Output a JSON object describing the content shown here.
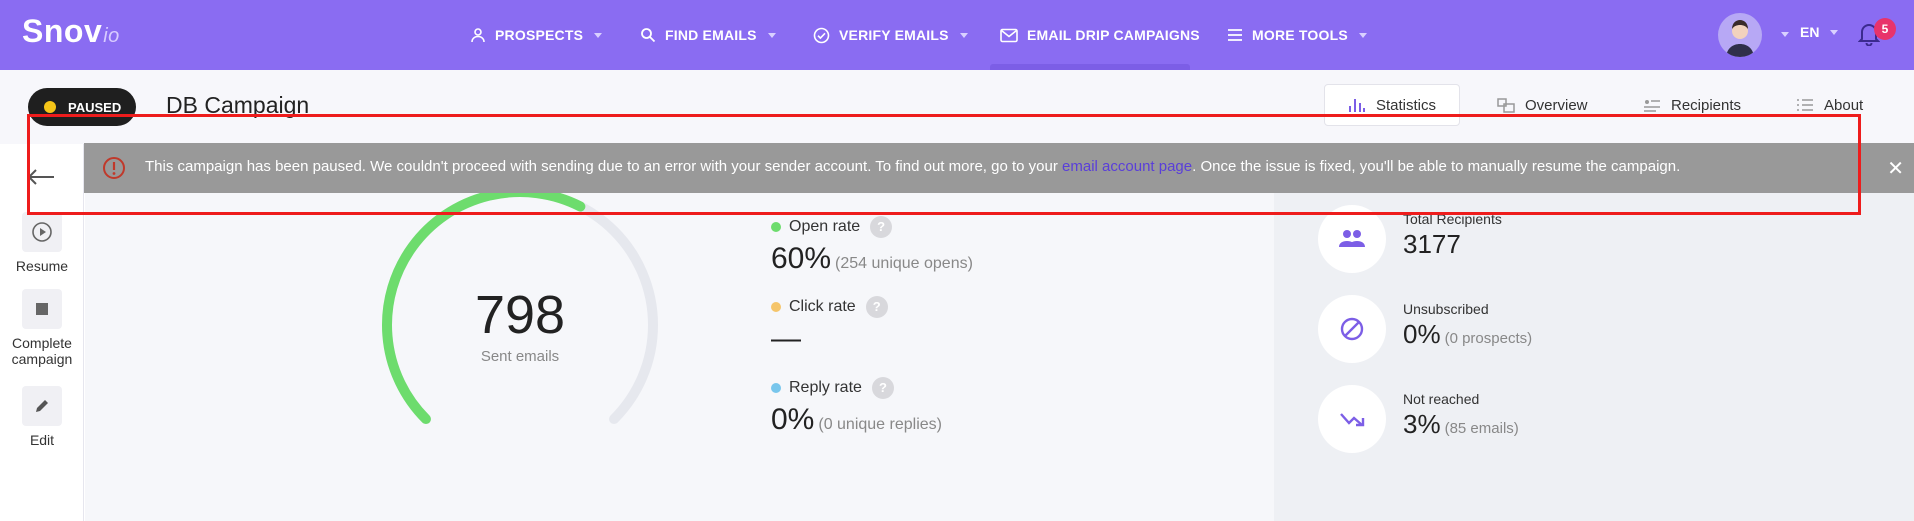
{
  "brand": {
    "logo_main": "Snov",
    "logo_suffix": "io"
  },
  "nav": {
    "items": [
      {
        "label": "PROSPECTS",
        "icon": "user-icon",
        "has_caret": true
      },
      {
        "label": "FIND EMAILS",
        "icon": "search-icon",
        "has_caret": true
      },
      {
        "label": "VERIFY EMAILS",
        "icon": "check-circle-icon",
        "has_caret": true
      },
      {
        "label": "EMAIL DRIP CAMPAIGNS",
        "icon": "mail-icon",
        "has_caret": false
      },
      {
        "label": "MORE TOOLS",
        "icon": "menu-icon",
        "has_caret": true
      }
    ],
    "language": "EN",
    "notifications_count": "5"
  },
  "campaign": {
    "status": "PAUSED",
    "title": "DB Campaign",
    "tabs": [
      {
        "label": "Statistics",
        "icon": "bar-chart-icon",
        "active": true
      },
      {
        "label": "Overview",
        "icon": "overview-icon",
        "active": false
      },
      {
        "label": "Recipients",
        "icon": "recipients-icon",
        "active": false
      },
      {
        "label": "About",
        "icon": "list-icon",
        "active": false
      }
    ]
  },
  "alert": {
    "text_before": "This campaign has been paused. We couldn't proceed with sending due to an error with your sender account. To find out more, go to your ",
    "link_text": "email account page",
    "text_after": ". Once the issue is fixed, you'll be able to manually resume the campaign."
  },
  "sidebar": {
    "actions": [
      {
        "label": "Resume",
        "icon": "play-icon"
      },
      {
        "label": "Complete campaign",
        "icon": "stop-icon"
      },
      {
        "label": "Edit",
        "icon": "pencil-icon"
      }
    ]
  },
  "summary": {
    "sent_count": "798",
    "sent_label": "Sent emails",
    "gauge_fraction": 0.6
  },
  "metrics": [
    {
      "label": "Open rate",
      "value": "60%",
      "sub": "(254 unique opens)",
      "color": "#6ddc6d"
    },
    {
      "label": "Click rate",
      "value": "—",
      "sub": "",
      "color": "#f5c56a"
    },
    {
      "label": "Reply rate",
      "value": "0%",
      "sub": "(0 unique replies)",
      "color": "#78c6ec"
    }
  ],
  "stats": [
    {
      "label": "Total Recipients",
      "value": "3177",
      "sub": "",
      "icon": "people-icon"
    },
    {
      "label": "Unsubscribed",
      "value": "0%",
      "sub": "(0 prospects)",
      "icon": "blocked-icon"
    },
    {
      "label": "Not reached",
      "value": "3%",
      "sub": "(85 emails)",
      "icon": "bounce-icon"
    }
  ],
  "colors": {
    "nav_bg": "#8a6cf2",
    "accent": "#7c5ee6",
    "alert_bg": "#999999",
    "alert_link": "#5a3fd9",
    "gauge_fill": "#6ddc6d",
    "gauge_track": "#e6e8ee"
  }
}
